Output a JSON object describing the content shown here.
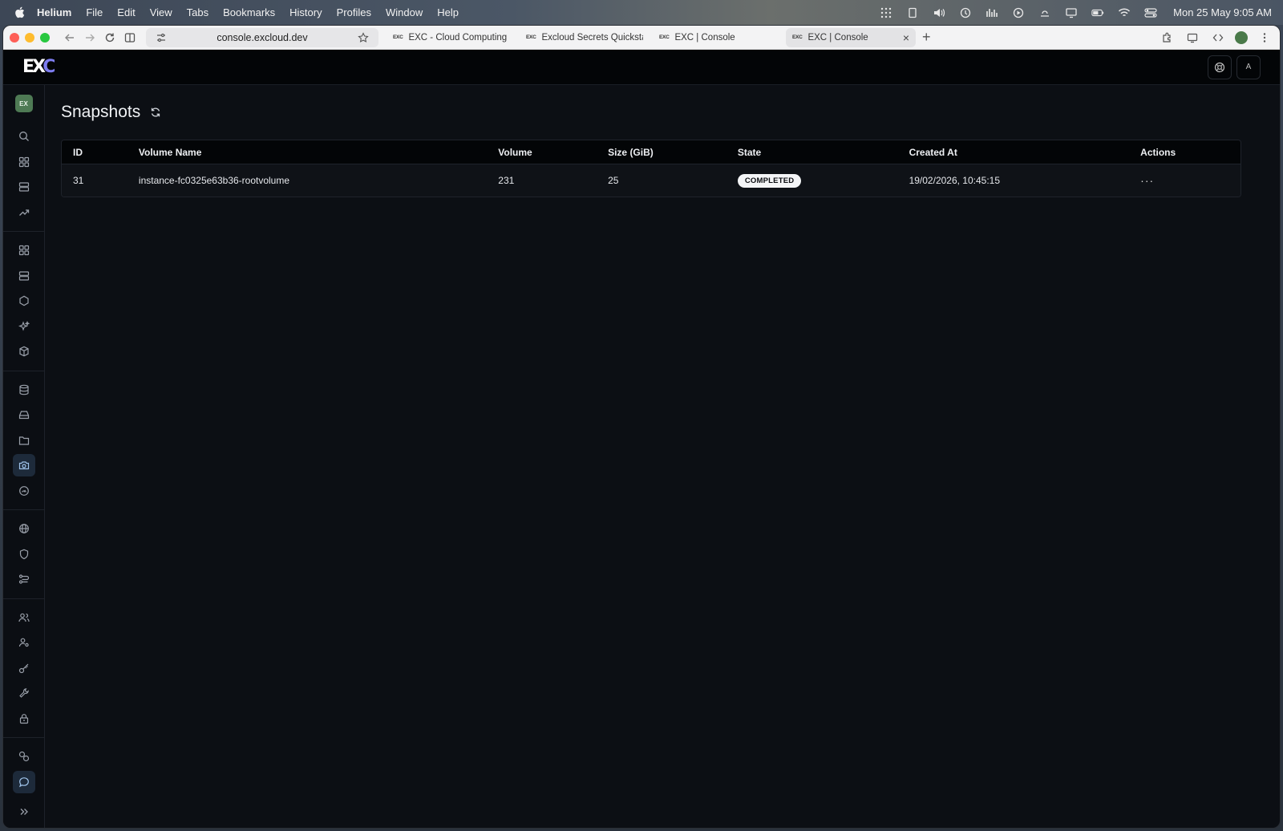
{
  "menubar": {
    "app": "Helium",
    "items": [
      "File",
      "Edit",
      "View",
      "Tabs",
      "Bookmarks",
      "History",
      "Profiles",
      "Window",
      "Help"
    ],
    "clock": "Mon 25 May  9:05 AM"
  },
  "browser": {
    "url": "console.excloud.dev",
    "tabs": [
      {
        "favicon": "EXC",
        "title": "EXC - Cloud Computing Serv"
      },
      {
        "favicon": "EXC",
        "title": "Excloud Secrets Quickstart"
      },
      {
        "favicon": "EXC",
        "title": "EXC | Console"
      },
      {
        "favicon": "EXC",
        "title": "EXC | Console",
        "close": "×"
      }
    ],
    "newtab": "+"
  },
  "app": {
    "logo_ex": "EX",
    "logo_c": "C",
    "avatar": "A",
    "workspace": "EX"
  },
  "page": {
    "title": "Snapshots"
  },
  "table": {
    "columns": [
      "ID",
      "Volume Name",
      "Volume",
      "Size (GiB)",
      "State",
      "Created At",
      "Actions"
    ],
    "rows": [
      {
        "id": "31",
        "volume_name": "instance-fc0325e63b36-rootvolume",
        "volume": "231",
        "size": "25",
        "state": "COMPLETED",
        "created_at": "19/02/2026, 10:45:15",
        "actions": "···"
      }
    ]
  },
  "colors": {
    "background": "#0c0f14",
    "accent": "#7d7df0",
    "workspace_badge": "#4e7a54",
    "status_badge": "#f4f5f7"
  }
}
